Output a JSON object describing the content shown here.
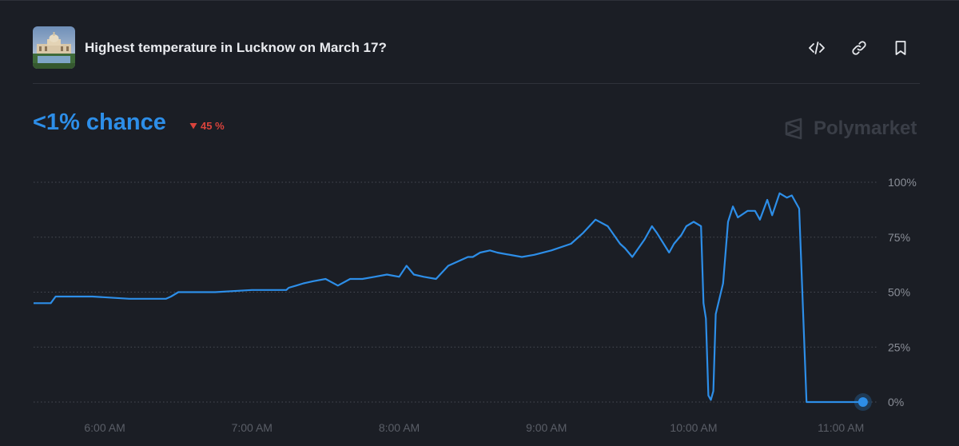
{
  "market": {
    "title": "Highest temperature in Lucknow on March 17?",
    "chance": "<1% chance",
    "change": "45 %",
    "change_direction": "down",
    "brand": "Polymarket"
  },
  "icons": {
    "embed": "code-icon",
    "link": "link-icon",
    "bookmark": "bookmark-icon",
    "change": "triangle-down-icon",
    "brand": "polymarket-logo-icon"
  },
  "colors": {
    "line": "#2d8ee8",
    "down": "#d9433c",
    "background": "#1b1e25"
  },
  "chart_data": {
    "type": "line",
    "title": "",
    "xlabel": "",
    "ylabel": "",
    "ylim": [
      0,
      100
    ],
    "xlim": [
      "5:31 AM",
      "11:11 AM"
    ],
    "y_ticks": [
      "100%",
      "75%",
      "50%",
      "25%",
      "0%"
    ],
    "x_ticks": [
      "6:00 AM",
      "7:00 AM",
      "8:00 AM",
      "9:00 AM",
      "10:00 AM",
      "11:00 AM"
    ],
    "grid": true,
    "grid_style": "dotted horizontal",
    "end_marker": true,
    "series": [
      {
        "values_unit": "percent",
        "x": [
          "5:31 AM",
          "5:38 AM",
          "5:40 AM",
          "5:45 AM",
          "5:55 AM",
          "6:10 AM",
          "6:25 AM",
          "6:27 AM",
          "6:30 AM",
          "6:45 AM",
          "7:00 AM",
          "7:14 AM",
          "7:15 AM",
          "7:18 AM",
          "7:21 AM",
          "7:25 AM",
          "7:30 AM",
          "7:35 AM",
          "7:40 AM",
          "7:45 AM",
          "7:50 AM",
          "7:55 AM",
          "8:00 AM",
          "8:03 AM",
          "8:06 AM",
          "8:10 AM",
          "8:15 AM",
          "8:20 AM",
          "8:28 AM",
          "8:30 AM",
          "8:33 AM",
          "8:37 AM",
          "8:40 AM",
          "8:50 AM",
          "8:55 AM",
          "9:02 AM",
          "9:10 AM",
          "9:15 AM",
          "9:20 AM",
          "9:25 AM",
          "9:30 AM",
          "9:32 AM",
          "9:35 AM",
          "9:40 AM",
          "9:43 AM",
          "9:45 AM",
          "9:50 AM",
          "9:52 AM",
          "9:55 AM",
          "9:57 AM",
          "10:00 AM",
          "10:03 AM",
          "10:04 AM",
          "10:05 AM",
          "10:06 AM",
          "10:07 AM",
          "10:08 AM",
          "10:09 AM",
          "10:12 AM",
          "10:14 AM",
          "10:16 AM",
          "10:18 AM",
          "10:22 AM",
          "10:25 AM",
          "10:27 AM",
          "10:30 AM",
          "10:32 AM",
          "10:35 AM",
          "10:38 AM",
          "10:40 AM",
          "10:43 AM",
          "10:46 AM",
          "10:49 AM",
          "10:50 AM",
          "10:51 AM",
          "10:55 AM",
          "11:00 AM",
          "11:05 AM",
          "11:09 AM"
        ],
        "values": [
          45,
          45,
          48,
          48,
          48,
          47,
          47,
          48,
          50,
          50,
          51,
          51,
          52,
          53,
          54,
          55,
          56,
          53,
          56,
          56,
          57,
          58,
          57,
          62,
          58,
          57,
          56,
          62,
          66,
          66,
          68,
          69,
          68,
          66,
          67,
          69,
          72,
          77,
          83,
          80,
          72,
          70,
          66,
          74,
          80,
          77,
          68,
          72,
          76,
          80,
          82,
          80,
          45,
          38,
          3,
          1,
          5,
          40,
          54,
          82,
          89,
          84,
          87,
          87,
          83,
          92,
          85,
          95,
          93,
          94,
          88,
          0,
          0,
          0,
          0,
          0,
          0,
          0,
          0
        ],
        "line_color": "#2d8ee8"
      }
    ]
  }
}
